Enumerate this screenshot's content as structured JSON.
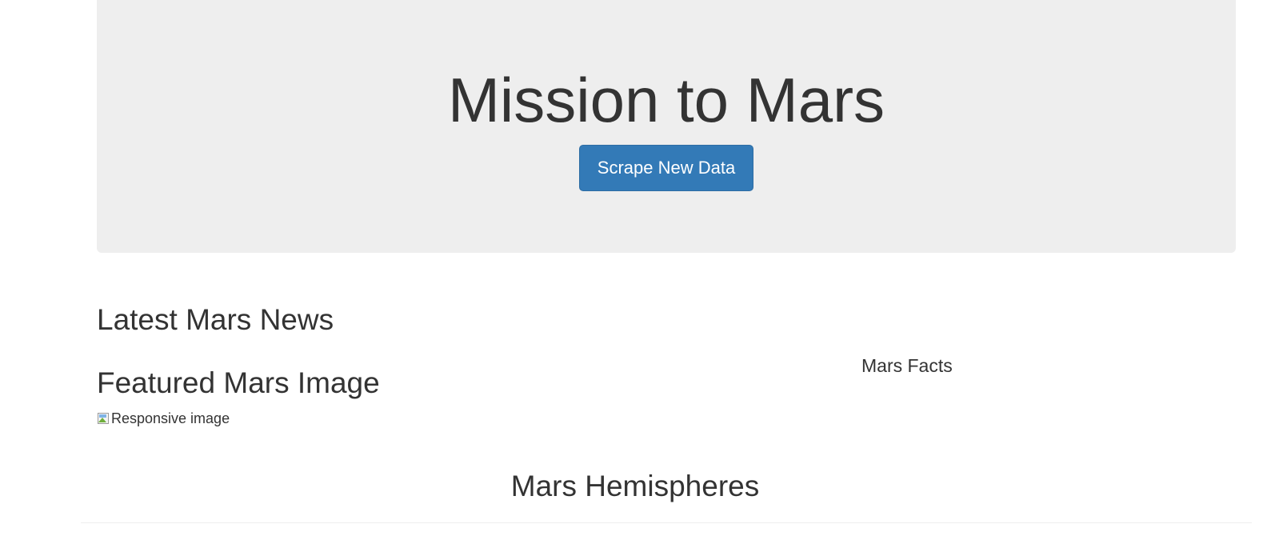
{
  "header": {
    "title": "Mission to Mars",
    "scrape_button_label": "Scrape New Data"
  },
  "news": {
    "heading": "Latest Mars News"
  },
  "featured_image": {
    "heading": "Featured Mars Image",
    "alt_text": "Responsive image",
    "icon": "broken-image-icon"
  },
  "facts": {
    "heading": "Mars Facts"
  },
  "hemispheres": {
    "heading": "Mars Hemispheres"
  },
  "colors": {
    "jumbotron_bg": "#eeeeee",
    "primary_button": "#337ab7",
    "text": "#333333"
  }
}
